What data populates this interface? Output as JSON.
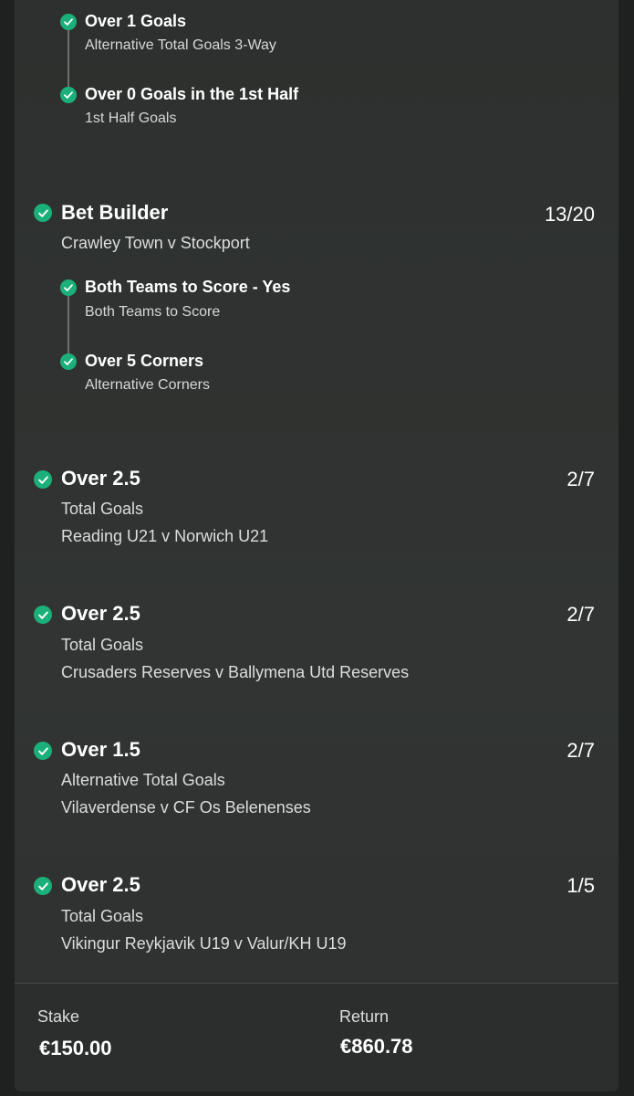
{
  "builder1_legs": [
    {
      "title": "Over 1 Goals",
      "market": "Alternative Total Goals 3-Way"
    },
    {
      "title": "Over 0 Goals in the 1st Half",
      "market": "1st Half Goals"
    }
  ],
  "builder2": {
    "title": "Bet Builder",
    "odds": "13/20",
    "event": "Crawley Town v Stockport",
    "legs": [
      {
        "title": "Both Teams to Score - Yes",
        "market": "Both Teams to Score"
      },
      {
        "title": "Over 5 Corners",
        "market": "Alternative Corners"
      }
    ]
  },
  "selections": [
    {
      "title": "Over 2.5",
      "odds": "2/7",
      "market": "Total Goals",
      "event": "Reading U21 v Norwich U21"
    },
    {
      "title": "Over 2.5",
      "odds": "2/7",
      "market": "Total Goals",
      "event": "Crusaders Reserves v Ballymena Utd Reserves"
    },
    {
      "title": "Over 1.5",
      "odds": "2/7",
      "market": "Alternative Total Goals",
      "event": "Vilaverdense v CF Os Belenenses"
    },
    {
      "title": "Over 2.5",
      "odds": "1/5",
      "market": "Total Goals",
      "event": "Vikingur Reykjavik U19 v Valur/KH U19"
    }
  ],
  "footer": {
    "stake_label": "Stake",
    "stake_value": "€150.00",
    "return_label": "Return",
    "return_value": "€860.78"
  },
  "colors": {
    "accent": "#1bb07a",
    "background": "#1f2120",
    "card": "#2f3230"
  },
  "icons": {
    "status": "check-circle-icon"
  }
}
